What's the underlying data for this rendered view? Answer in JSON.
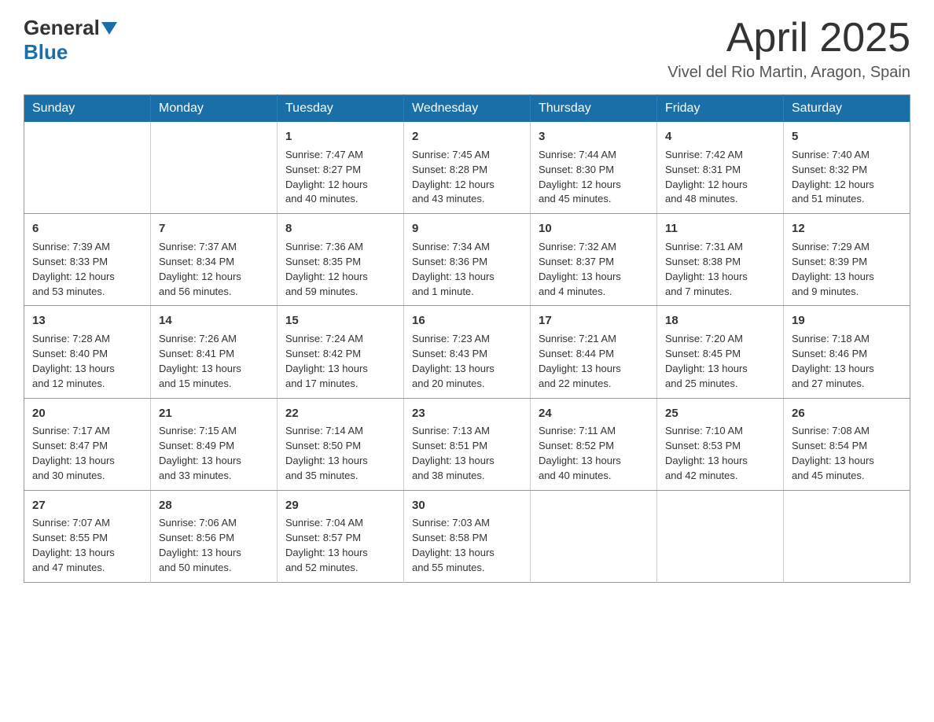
{
  "header": {
    "logo_general": "General",
    "logo_blue": "Blue",
    "month": "April 2025",
    "location": "Vivel del Rio Martin, Aragon, Spain"
  },
  "weekdays": [
    "Sunday",
    "Monday",
    "Tuesday",
    "Wednesday",
    "Thursday",
    "Friday",
    "Saturday"
  ],
  "weeks": [
    [
      {
        "day": "",
        "info": ""
      },
      {
        "day": "",
        "info": ""
      },
      {
        "day": "1",
        "info": "Sunrise: 7:47 AM\nSunset: 8:27 PM\nDaylight: 12 hours\nand 40 minutes."
      },
      {
        "day": "2",
        "info": "Sunrise: 7:45 AM\nSunset: 8:28 PM\nDaylight: 12 hours\nand 43 minutes."
      },
      {
        "day": "3",
        "info": "Sunrise: 7:44 AM\nSunset: 8:30 PM\nDaylight: 12 hours\nand 45 minutes."
      },
      {
        "day": "4",
        "info": "Sunrise: 7:42 AM\nSunset: 8:31 PM\nDaylight: 12 hours\nand 48 minutes."
      },
      {
        "day": "5",
        "info": "Sunrise: 7:40 AM\nSunset: 8:32 PM\nDaylight: 12 hours\nand 51 minutes."
      }
    ],
    [
      {
        "day": "6",
        "info": "Sunrise: 7:39 AM\nSunset: 8:33 PM\nDaylight: 12 hours\nand 53 minutes."
      },
      {
        "day": "7",
        "info": "Sunrise: 7:37 AM\nSunset: 8:34 PM\nDaylight: 12 hours\nand 56 minutes."
      },
      {
        "day": "8",
        "info": "Sunrise: 7:36 AM\nSunset: 8:35 PM\nDaylight: 12 hours\nand 59 minutes."
      },
      {
        "day": "9",
        "info": "Sunrise: 7:34 AM\nSunset: 8:36 PM\nDaylight: 13 hours\nand 1 minute."
      },
      {
        "day": "10",
        "info": "Sunrise: 7:32 AM\nSunset: 8:37 PM\nDaylight: 13 hours\nand 4 minutes."
      },
      {
        "day": "11",
        "info": "Sunrise: 7:31 AM\nSunset: 8:38 PM\nDaylight: 13 hours\nand 7 minutes."
      },
      {
        "day": "12",
        "info": "Sunrise: 7:29 AM\nSunset: 8:39 PM\nDaylight: 13 hours\nand 9 minutes."
      }
    ],
    [
      {
        "day": "13",
        "info": "Sunrise: 7:28 AM\nSunset: 8:40 PM\nDaylight: 13 hours\nand 12 minutes."
      },
      {
        "day": "14",
        "info": "Sunrise: 7:26 AM\nSunset: 8:41 PM\nDaylight: 13 hours\nand 15 minutes."
      },
      {
        "day": "15",
        "info": "Sunrise: 7:24 AM\nSunset: 8:42 PM\nDaylight: 13 hours\nand 17 minutes."
      },
      {
        "day": "16",
        "info": "Sunrise: 7:23 AM\nSunset: 8:43 PM\nDaylight: 13 hours\nand 20 minutes."
      },
      {
        "day": "17",
        "info": "Sunrise: 7:21 AM\nSunset: 8:44 PM\nDaylight: 13 hours\nand 22 minutes."
      },
      {
        "day": "18",
        "info": "Sunrise: 7:20 AM\nSunset: 8:45 PM\nDaylight: 13 hours\nand 25 minutes."
      },
      {
        "day": "19",
        "info": "Sunrise: 7:18 AM\nSunset: 8:46 PM\nDaylight: 13 hours\nand 27 minutes."
      }
    ],
    [
      {
        "day": "20",
        "info": "Sunrise: 7:17 AM\nSunset: 8:47 PM\nDaylight: 13 hours\nand 30 minutes."
      },
      {
        "day": "21",
        "info": "Sunrise: 7:15 AM\nSunset: 8:49 PM\nDaylight: 13 hours\nand 33 minutes."
      },
      {
        "day": "22",
        "info": "Sunrise: 7:14 AM\nSunset: 8:50 PM\nDaylight: 13 hours\nand 35 minutes."
      },
      {
        "day": "23",
        "info": "Sunrise: 7:13 AM\nSunset: 8:51 PM\nDaylight: 13 hours\nand 38 minutes."
      },
      {
        "day": "24",
        "info": "Sunrise: 7:11 AM\nSunset: 8:52 PM\nDaylight: 13 hours\nand 40 minutes."
      },
      {
        "day": "25",
        "info": "Sunrise: 7:10 AM\nSunset: 8:53 PM\nDaylight: 13 hours\nand 42 minutes."
      },
      {
        "day": "26",
        "info": "Sunrise: 7:08 AM\nSunset: 8:54 PM\nDaylight: 13 hours\nand 45 minutes."
      }
    ],
    [
      {
        "day": "27",
        "info": "Sunrise: 7:07 AM\nSunset: 8:55 PM\nDaylight: 13 hours\nand 47 minutes."
      },
      {
        "day": "28",
        "info": "Sunrise: 7:06 AM\nSunset: 8:56 PM\nDaylight: 13 hours\nand 50 minutes."
      },
      {
        "day": "29",
        "info": "Sunrise: 7:04 AM\nSunset: 8:57 PM\nDaylight: 13 hours\nand 52 minutes."
      },
      {
        "day": "30",
        "info": "Sunrise: 7:03 AM\nSunset: 8:58 PM\nDaylight: 13 hours\nand 55 minutes."
      },
      {
        "day": "",
        "info": ""
      },
      {
        "day": "",
        "info": ""
      },
      {
        "day": "",
        "info": ""
      }
    ]
  ]
}
